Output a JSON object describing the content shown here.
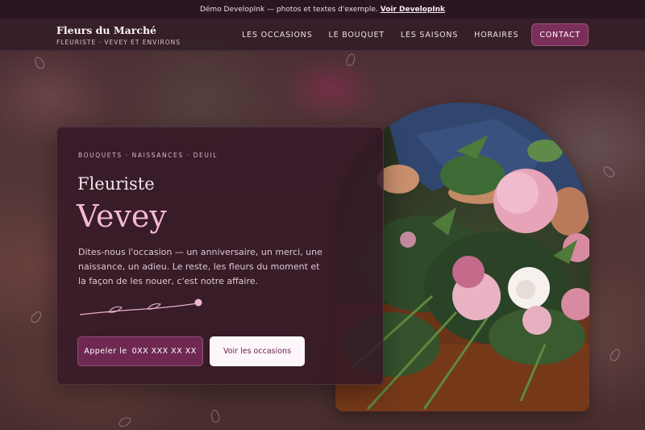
{
  "demo_bar": {
    "text": "Démo DevelopInk — photos et textes d'exemple.",
    "link": "Voir DevelopInk"
  },
  "brand": {
    "name": "Fleurs du Marché",
    "tagline": "FLEURISTE · VEVEY ET ENVIRONS"
  },
  "nav": {
    "items": [
      {
        "label": "LES OCCASIONS"
      },
      {
        "label": "LE BOUQUET"
      },
      {
        "label": "LES SAISONS"
      },
      {
        "label": "HORAIRES"
      }
    ],
    "cta": "CONTACT"
  },
  "hero": {
    "eyebrow": "BOUQUETS · NAISSANCES · DEUIL",
    "title_line1": "Fleuriste",
    "title_line2": "Vevey",
    "description": "Dites-nous l'occasion — un anniversaire, un merci, une naissance, un adieu. Le reste, les fleurs du moment et la façon de les nouer, c'est notre affaire.",
    "call_prefix": "Appeler le",
    "call_number": "0XX XXX XX XX",
    "secondary_button": "Voir les occasions"
  },
  "colors": {
    "accent": "#7a2e5a",
    "title_pink": "#f3b7d4",
    "card_bg": "#341826"
  },
  "icons": {
    "vine": "vine-divider-icon",
    "photo": "flower-arrangement-photo"
  }
}
